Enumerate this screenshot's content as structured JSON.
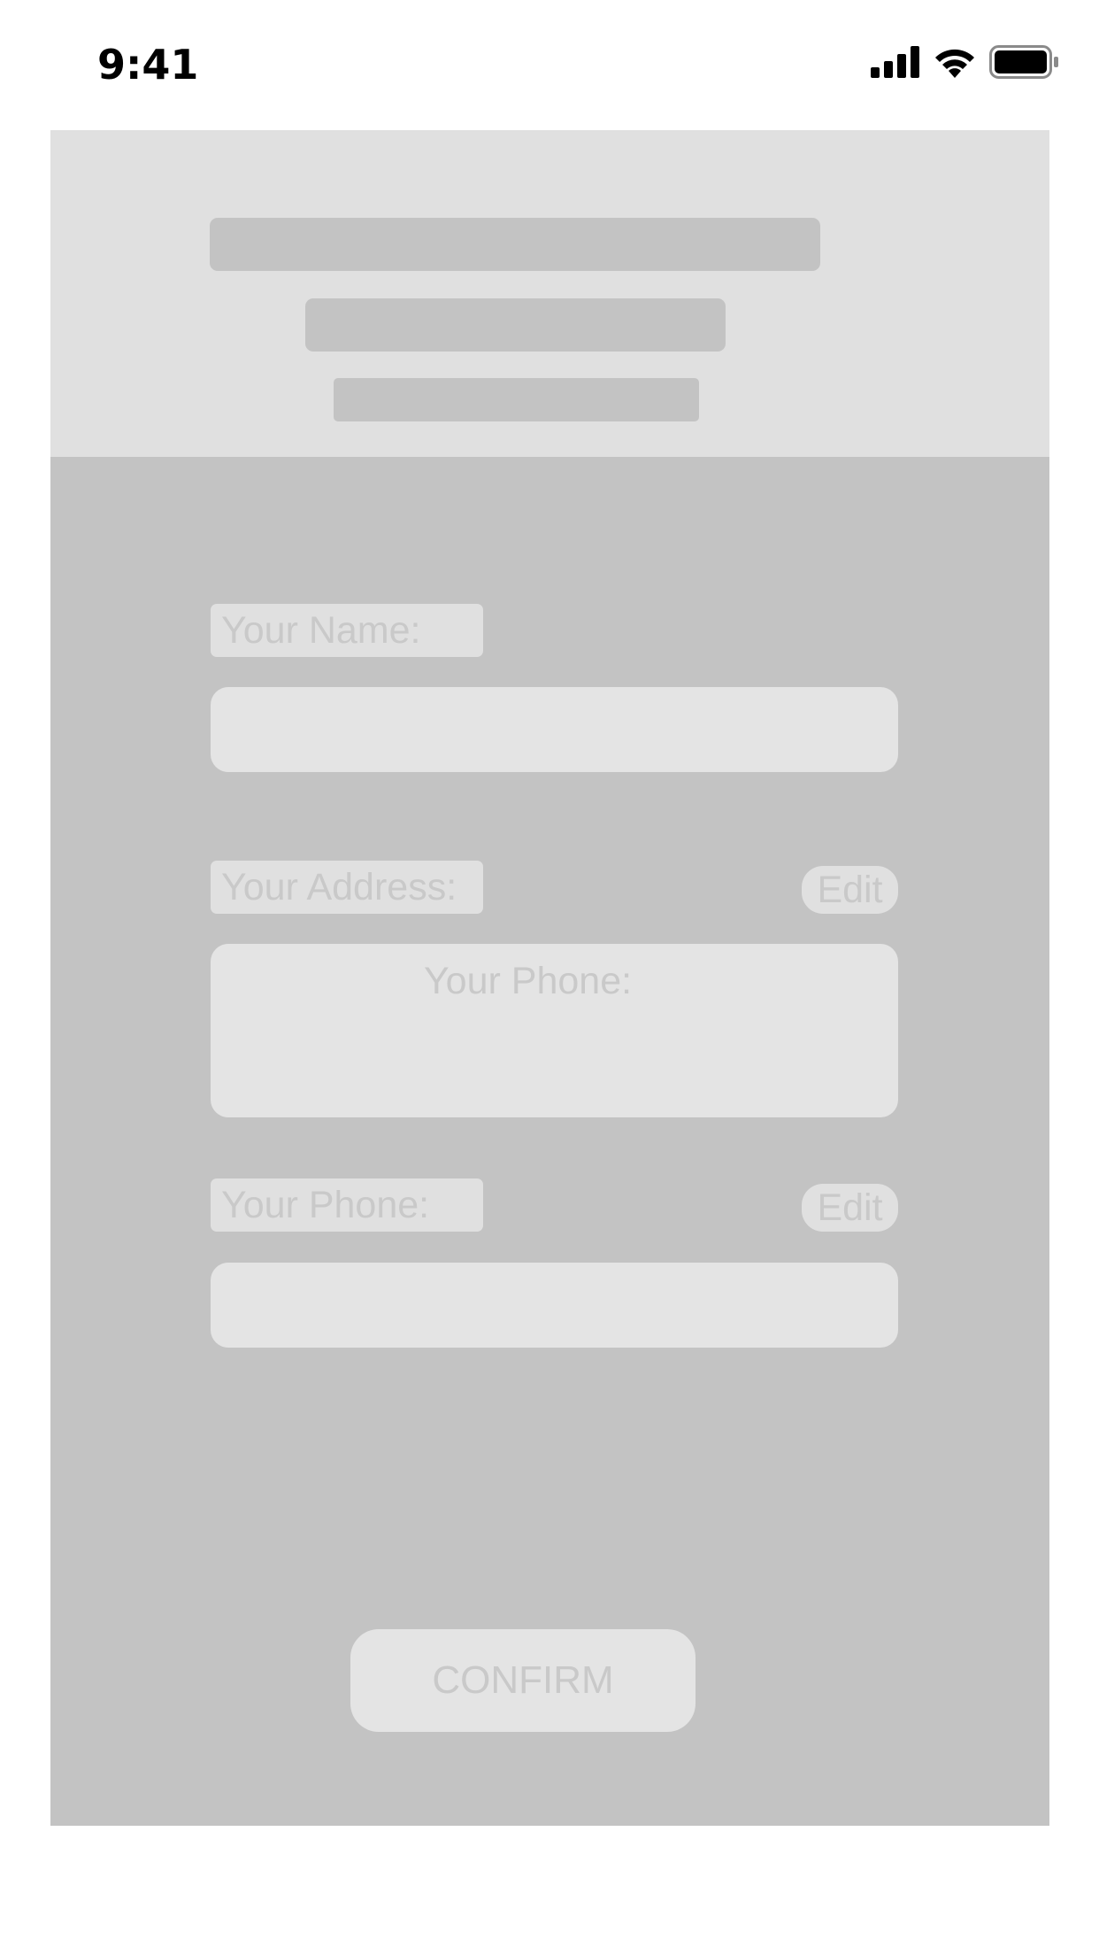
{
  "status_bar": {
    "time": "9:41"
  },
  "form": {
    "name_label": "Your Name:",
    "address_label": "Your Address:",
    "address_edit": "Edit",
    "address_placeholder": "Your Phone:",
    "phone_label": "Your Phone:",
    "phone_edit": "Edit",
    "confirm_label": "CONFIRM"
  },
  "colors": {
    "frame": "#c3c3c3",
    "header": "#e0e0e0",
    "input": "#e4e4e4",
    "muted_text": "#c9c9c9"
  },
  "icons": [
    "signal-icon",
    "wifi-icon",
    "battery-icon"
  ]
}
